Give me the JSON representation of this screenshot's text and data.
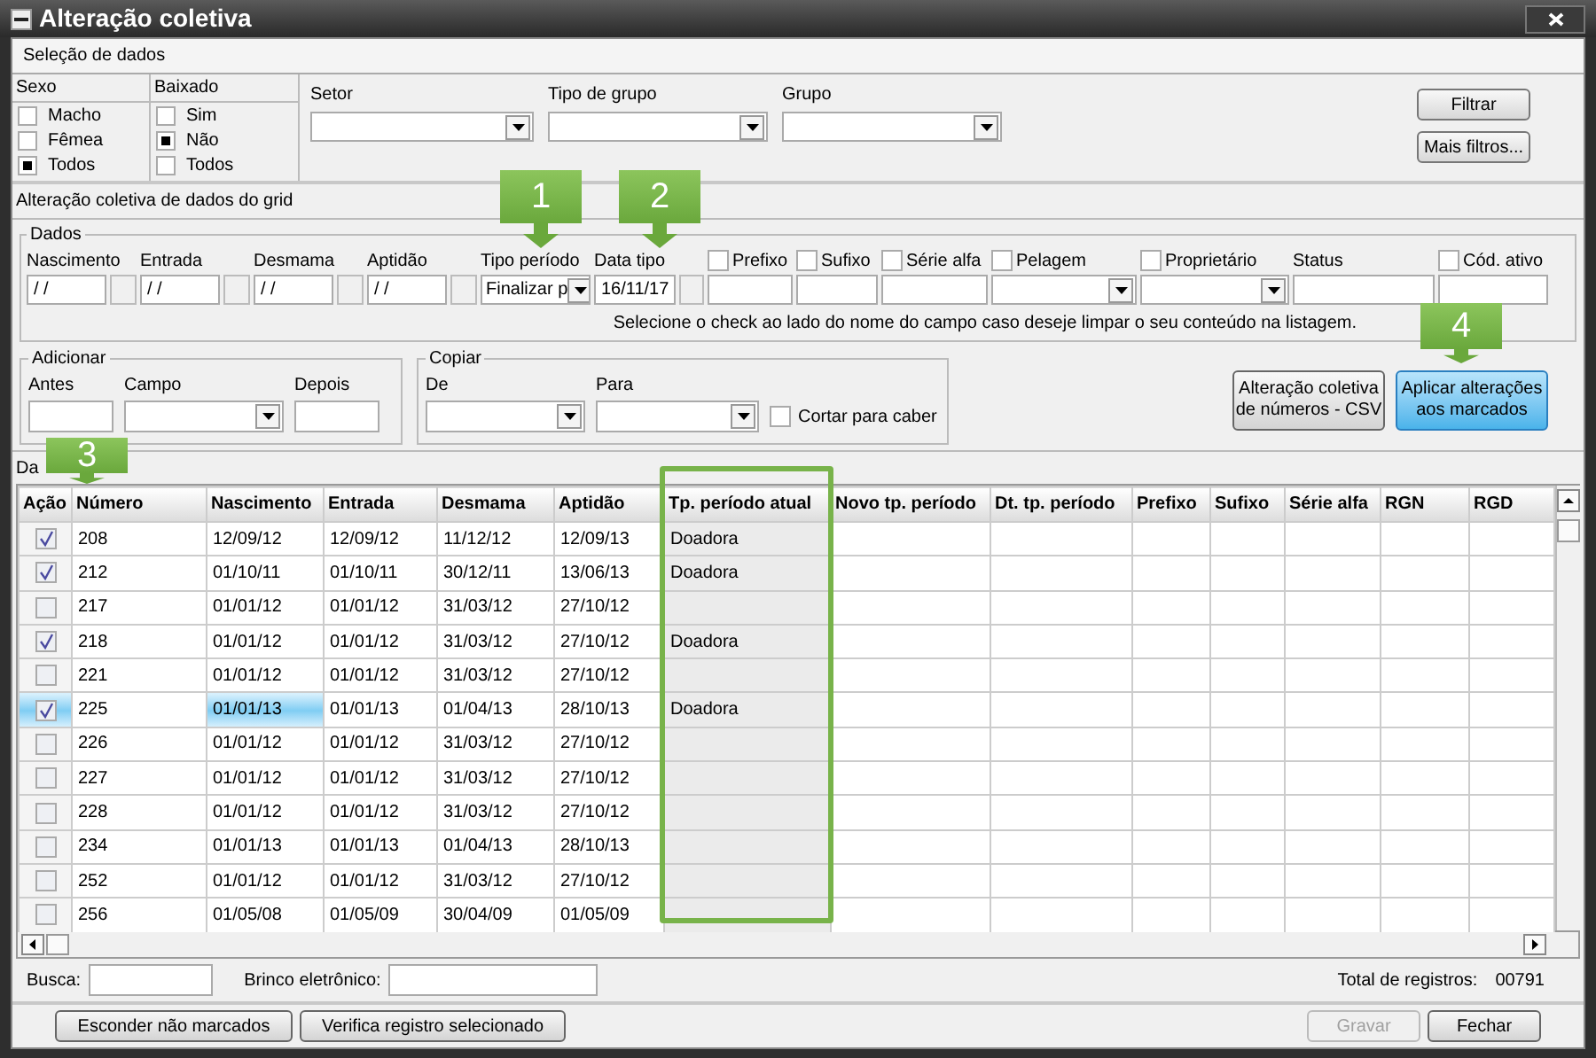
{
  "window": {
    "title": "Alteração coletiva"
  },
  "selection": {
    "header": "Seleção de dados",
    "sexo": {
      "label": "Sexo",
      "options": [
        {
          "label": "Macho",
          "selected": false
        },
        {
          "label": "Fêmea",
          "selected": false
        },
        {
          "label": "Todos",
          "selected": true
        }
      ]
    },
    "baixado": {
      "label": "Baixado",
      "options": [
        {
          "label": "Sim",
          "selected": false
        },
        {
          "label": "Não",
          "selected": true
        },
        {
          "label": "Todos",
          "selected": false
        }
      ]
    },
    "dropdowns": [
      {
        "label": "Setor"
      },
      {
        "label": "Tipo de grupo"
      },
      {
        "label": "Grupo"
      }
    ],
    "buttons": [
      "Filtrar",
      "Mais filtros..."
    ]
  },
  "grid_edit": {
    "header": "Alteração coletiva de dados do grid",
    "dados": {
      "legend": "Dados",
      "fields": [
        {
          "kind": "date",
          "label": "Nascimento",
          "value": "/ /"
        },
        {
          "kind": "date",
          "label": "Entrada",
          "value": "/ /"
        },
        {
          "kind": "date",
          "label": "Desmama",
          "value": "/ /"
        },
        {
          "kind": "date",
          "label": "Aptidão",
          "value": "/ /"
        },
        {
          "kind": "dropdown",
          "label": "Tipo período",
          "value": "Finalizar p"
        },
        {
          "kind": "date",
          "label": "Data tipo",
          "value": "16/11/17"
        },
        {
          "kind": "text",
          "label": "Prefixo",
          "checked": false
        },
        {
          "kind": "text",
          "label": "Sufixo",
          "checked": false
        },
        {
          "kind": "text",
          "label": "Série alfa",
          "checked": false
        },
        {
          "kind": "dropdown",
          "label": "Pelagem",
          "checked": false
        },
        {
          "kind": "dropdown",
          "label": "Proprietário",
          "checked": false
        },
        {
          "kind": "text",
          "label": "Status"
        },
        {
          "kind": "text",
          "label": "Cód. ativo",
          "checked": false
        }
      ],
      "hint": "Selecione o check ao lado do nome do campo caso deseje limpar o seu conteúdo na listagem."
    },
    "adicionar": {
      "legend": "Adicionar",
      "fields": [
        {
          "kind": "text",
          "label": "Antes"
        },
        {
          "kind": "dropdown",
          "label": "Campo"
        },
        {
          "kind": "text",
          "label": "Depois"
        }
      ]
    },
    "copiar": {
      "legend": "Copiar",
      "fields": [
        {
          "kind": "dropdown",
          "label": "De"
        },
        {
          "kind": "dropdown",
          "label": "Para"
        }
      ],
      "option": {
        "label": "Cortar para caber",
        "checked": false
      }
    },
    "buttons": [
      {
        "label": "Alteração coletiva de números - CSV",
        "primary": false
      },
      {
        "label": "Aplicar alterações aos marcados",
        "primary": true
      }
    ]
  },
  "table": {
    "label": "Da",
    "columns": [
      "Ação",
      "Número",
      "Nascimento",
      "Entrada",
      "Desmama",
      "Aptidão",
      "Tp. período atual",
      "Novo tp. período",
      "Dt. tp. período",
      "Prefixo",
      "Sufixo",
      "Série alfa",
      "RGN",
      "RGD"
    ],
    "rows": [
      {
        "checked": true,
        "selected": false,
        "cells": [
          "",
          "208",
          "12/09/12",
          "12/09/12",
          "11/12/12",
          "12/09/13",
          "Doadora"
        ]
      },
      {
        "checked": true,
        "selected": false,
        "cells": [
          "",
          "212",
          "01/10/11",
          "01/10/11",
          "30/12/11",
          "13/06/13",
          "Doadora"
        ]
      },
      {
        "checked": false,
        "selected": false,
        "cells": [
          "",
          "217",
          "01/01/12",
          "01/01/12",
          "31/03/12",
          "27/10/12",
          ""
        ]
      },
      {
        "checked": true,
        "selected": false,
        "cells": [
          "",
          "218",
          "01/01/12",
          "01/01/12",
          "31/03/12",
          "27/10/12",
          "Doadora"
        ]
      },
      {
        "checked": false,
        "selected": false,
        "cells": [
          "",
          "221",
          "01/01/12",
          "01/01/12",
          "31/03/12",
          "27/10/12",
          ""
        ]
      },
      {
        "checked": true,
        "selected": true,
        "cells": [
          "",
          "225",
          "01/01/13",
          "01/01/13",
          "01/04/13",
          "28/10/13",
          "Doadora"
        ]
      },
      {
        "checked": false,
        "selected": false,
        "cells": [
          "",
          "226",
          "01/01/12",
          "01/01/12",
          "31/03/12",
          "27/10/12",
          ""
        ]
      },
      {
        "checked": false,
        "selected": false,
        "cells": [
          "",
          "227",
          "01/01/12",
          "01/01/12",
          "31/03/12",
          "27/10/12",
          ""
        ]
      },
      {
        "checked": false,
        "selected": false,
        "cells": [
          "",
          "228",
          "01/01/12",
          "01/01/12",
          "31/03/12",
          "27/10/12",
          ""
        ]
      },
      {
        "checked": false,
        "selected": false,
        "cells": [
          "",
          "234",
          "01/01/13",
          "01/01/13",
          "01/04/13",
          "28/10/13",
          ""
        ]
      },
      {
        "checked": false,
        "selected": false,
        "cells": [
          "",
          "252",
          "01/01/12",
          "01/01/12",
          "31/03/12",
          "27/10/12",
          ""
        ]
      },
      {
        "checked": false,
        "selected": false,
        "cells": [
          "",
          "256",
          "01/05/08",
          "01/05/09",
          "30/04/09",
          "01/05/09",
          ""
        ]
      }
    ]
  },
  "footer": {
    "search_label": "Busca:",
    "tag_label": "Brinco eletrônico:",
    "total_label": "Total de registros:",
    "total_value": "00791"
  },
  "actions": [
    {
      "label": "Esconder não marcados",
      "disabled": false
    },
    {
      "label": "Verifica registro selecionado",
      "disabled": false
    },
    {
      "label": "Gravar",
      "disabled": true
    },
    {
      "label": "Fechar",
      "disabled": false
    }
  ],
  "callouts": [
    {
      "label": "1"
    },
    {
      "label": "2"
    },
    {
      "label": "3"
    },
    {
      "label": "4"
    }
  ]
}
